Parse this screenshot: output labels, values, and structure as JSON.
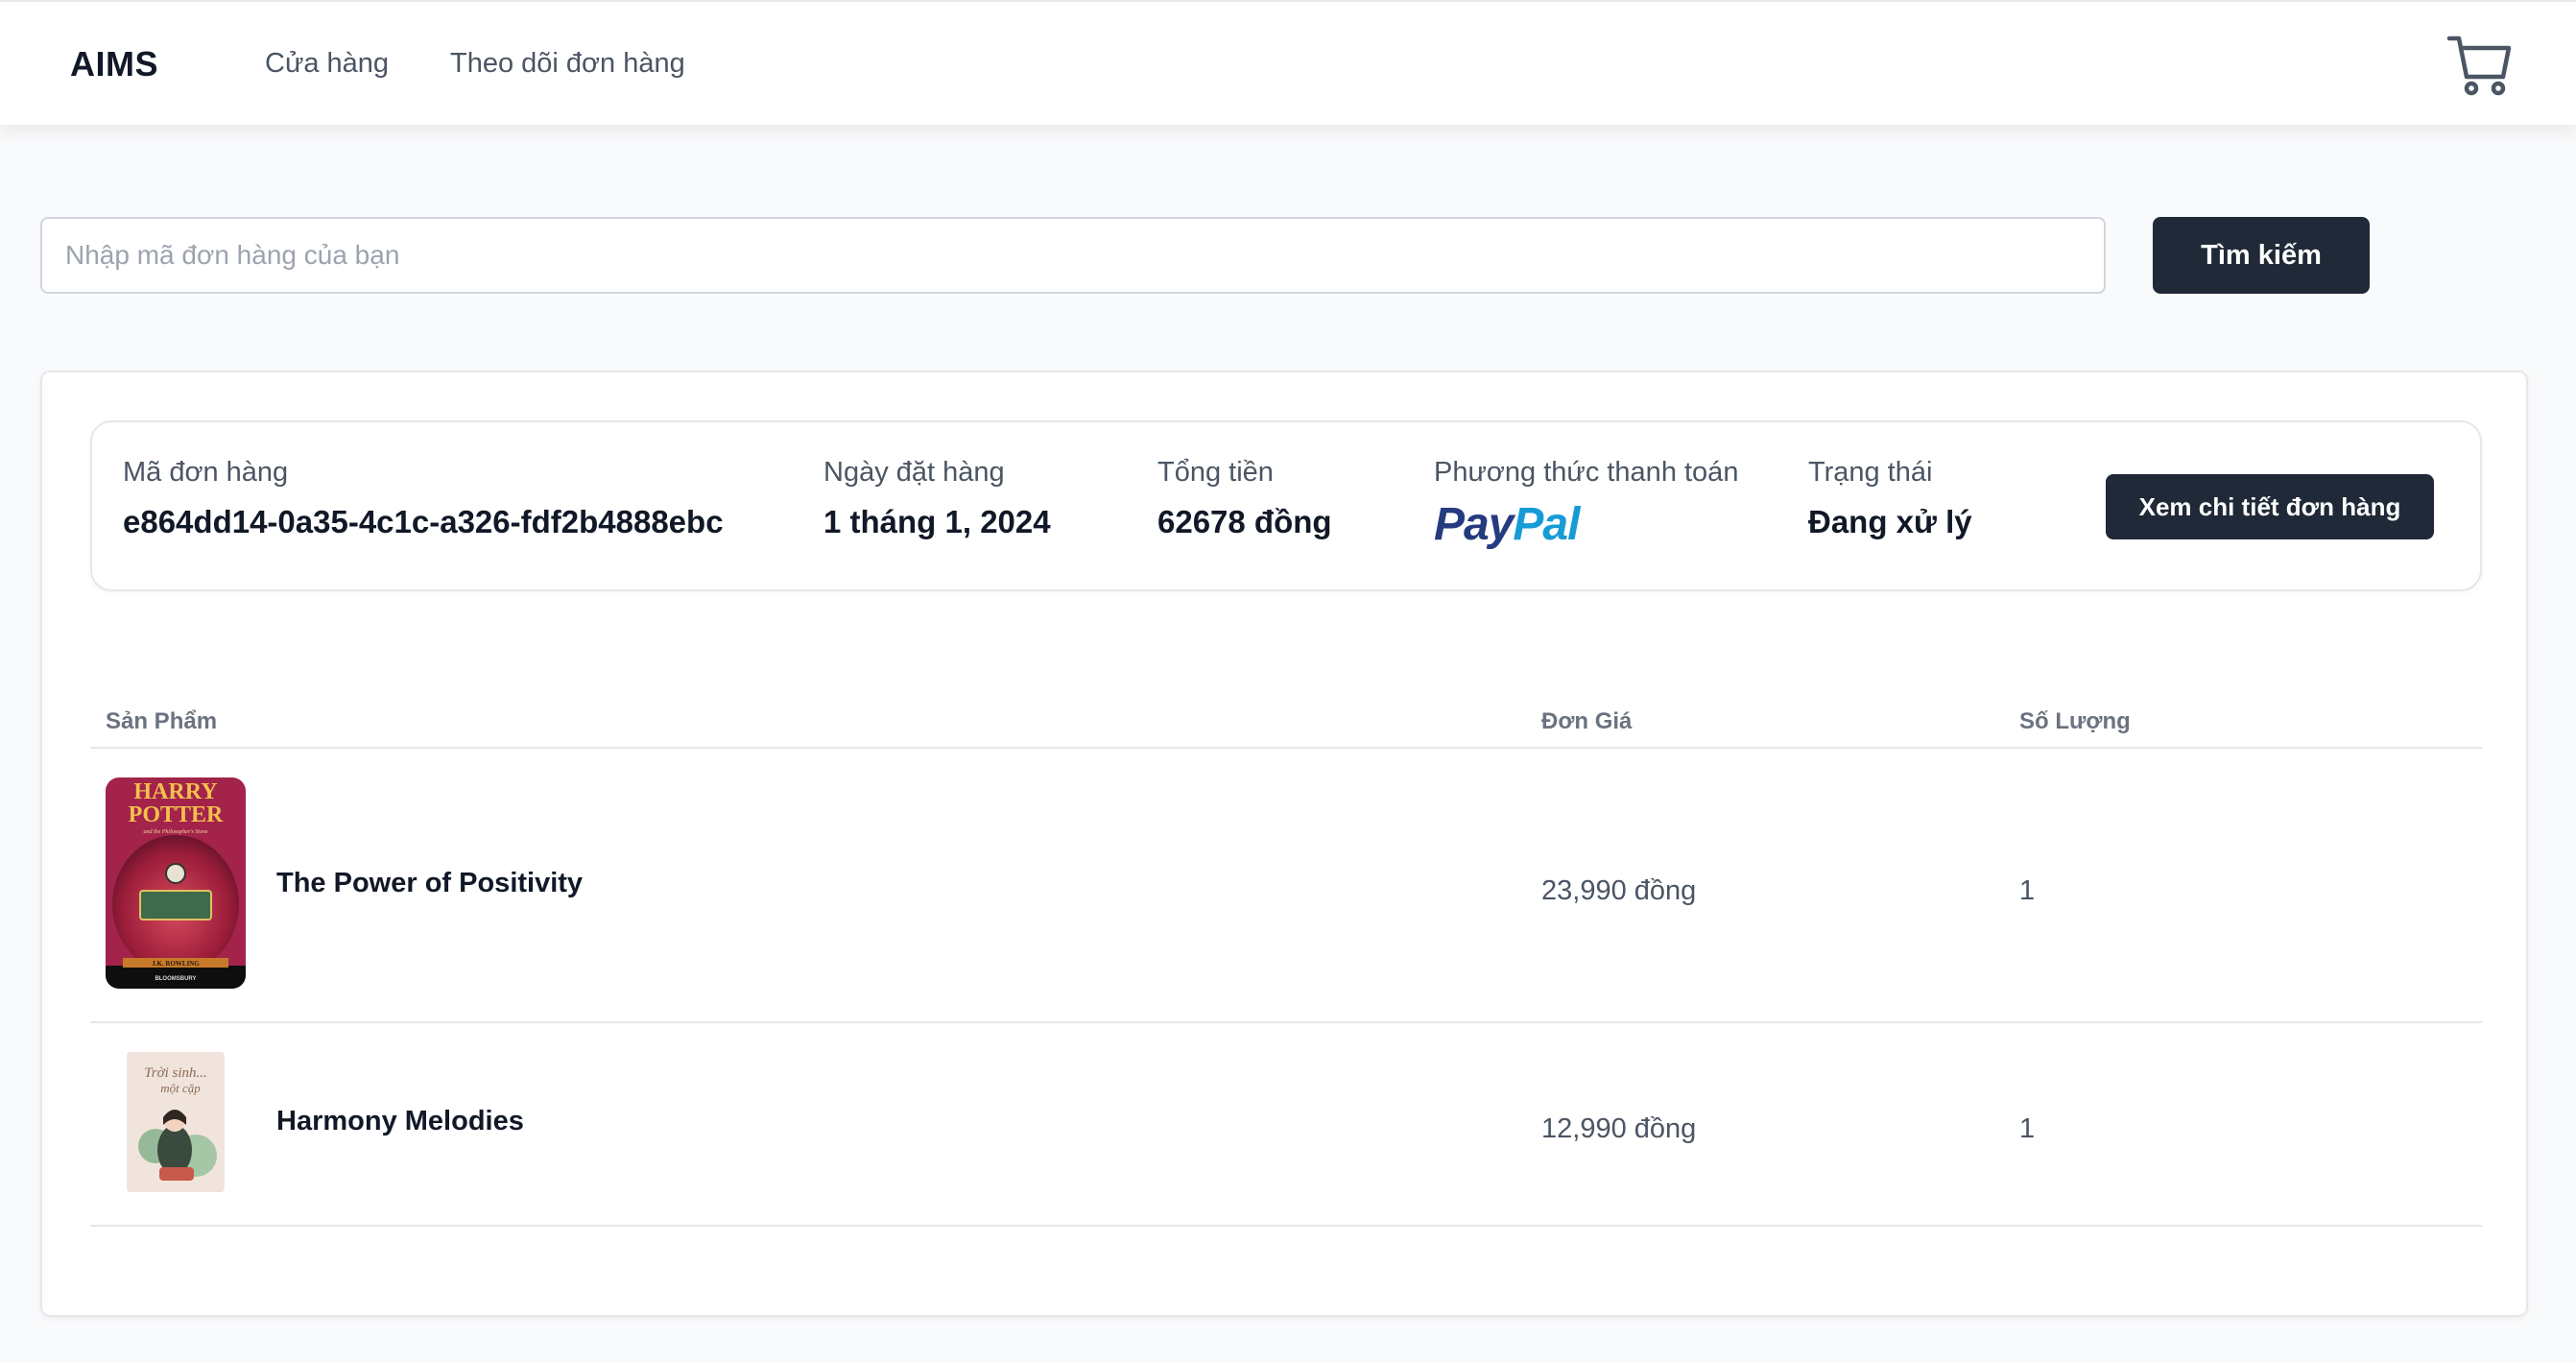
{
  "header": {
    "brand": "AIMS",
    "nav": {
      "shop": "Cửa hàng",
      "track": "Theo dõi đơn hàng"
    },
    "cart_icon": "shopping-cart-icon"
  },
  "search": {
    "placeholder": "Nhập mã đơn hàng của bạn",
    "value": "",
    "button_label": "Tìm kiếm"
  },
  "order": {
    "id_label": "Mã đơn hàng",
    "id_value": "e864dd14-0a35-4c1c-a326-fdf2b4888ebc",
    "date_label": "Ngày đặt hàng",
    "date_value": "1 tháng 1, 2024",
    "total_label": "Tổng tiền",
    "total_value": "62678 đồng",
    "payment_label": "Phương thức thanh toán",
    "payment_logo": {
      "part1": "Pay",
      "part2": "Pal"
    },
    "status_label": "Trạng thái",
    "status_value": "Đang xử lý",
    "detail_button": "Xem chi tiết đơn hàng"
  },
  "table": {
    "headers": {
      "product": "Sản Phẩm",
      "unit_price": "Đơn Giá",
      "quantity": "Số Lượng"
    },
    "rows": [
      {
        "name": "The Power of Positivity",
        "price": "23,990 đồng",
        "quantity": "1",
        "thumb": {
          "line1": "HARRY",
          "line2": "POTTER",
          "sub": "and the Philosopher's Stone",
          "author": "J.K. ROWLING",
          "publisher": "BLOOMSBURY"
        }
      },
      {
        "name": "Harmony Melodies",
        "price": "12,990 đồng",
        "quantity": "1",
        "thumb": {
          "line1": "Trời sinh...",
          "line2": "một cặp"
        }
      }
    ]
  },
  "colors": {
    "primary_button": "#1f2937",
    "paypal_dark": "#253b80",
    "paypal_light": "#179bd7",
    "muted_text": "#4b5563"
  }
}
